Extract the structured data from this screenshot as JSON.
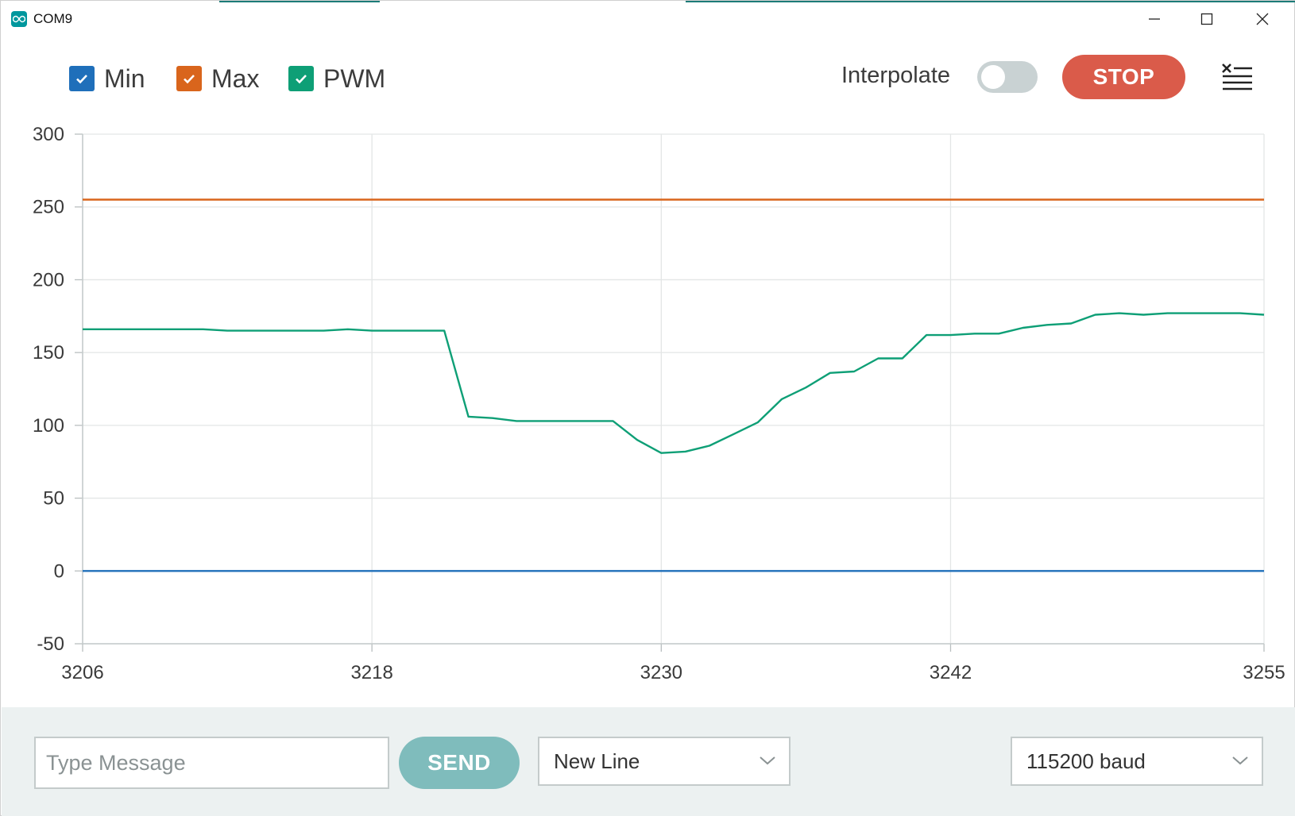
{
  "window": {
    "title": "COM9",
    "icons": {
      "app": "arduino-infinity-icon",
      "minimize": "minimize-icon",
      "maximize": "maximize-icon",
      "close": "close-icon"
    }
  },
  "toolbar": {
    "legend": [
      {
        "label": "Min",
        "checked": true,
        "color": "#1f6fba"
      },
      {
        "label": "Max",
        "checked": true,
        "color": "#d9651c"
      },
      {
        "label": "PWM",
        "checked": true,
        "color": "#0e9f76"
      }
    ],
    "interpolate_label": "Interpolate",
    "interpolate_on": false,
    "stop_label": "STOP",
    "clear_icon": "clear-list-icon"
  },
  "chart_data": {
    "type": "line",
    "xlim": [
      3206,
      3255
    ],
    "ylim": [
      -50,
      300
    ],
    "x_ticks": [
      "3206",
      "3218",
      "3230",
      "3242",
      "3255"
    ],
    "y_ticks": [
      "300",
      "250",
      "200",
      "150",
      "100",
      "50",
      "0",
      "-50"
    ],
    "grid": true,
    "series": [
      {
        "name": "Min",
        "color": "#1f6fba",
        "x": [
          3206,
          3255
        ],
        "y": [
          0,
          0
        ]
      },
      {
        "name": "Max",
        "color": "#d9651c",
        "x": [
          3206,
          3255
        ],
        "y": [
          255,
          255
        ]
      },
      {
        "name": "PWM",
        "color": "#0e9f76",
        "x": [
          3206,
          3211,
          3212,
          3215,
          3216,
          3217,
          3218,
          3219,
          3220,
          3221,
          3222,
          3223,
          3224,
          3225,
          3226,
          3227,
          3228,
          3229,
          3230,
          3231,
          3232,
          3233,
          3234,
          3235,
          3236,
          3237,
          3238,
          3239,
          3240,
          3241,
          3242,
          3243,
          3244,
          3245,
          3246,
          3247,
          3248,
          3249,
          3250,
          3251,
          3252,
          3253,
          3254,
          3255
        ],
        "y": [
          166,
          166,
          165,
          165,
          165,
          166,
          165,
          165,
          165,
          165,
          106,
          105,
          103,
          103,
          103,
          103,
          103,
          90,
          81,
          82,
          86,
          94,
          102,
          118,
          126,
          136,
          137,
          146,
          146,
          162,
          162,
          163,
          163,
          167,
          169,
          170,
          176,
          177,
          176,
          177,
          177,
          177,
          177,
          176
        ]
      }
    ]
  },
  "bottom": {
    "message_placeholder": "Type Message",
    "send_label": "SEND",
    "line_ending": "New Line",
    "baud": "115200 baud"
  }
}
